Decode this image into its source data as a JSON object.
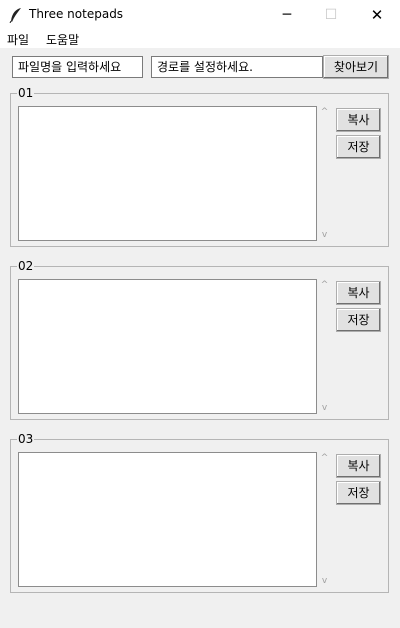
{
  "window": {
    "title": "Three notepads",
    "minimize": "─",
    "maximize": "☐",
    "close": "✕"
  },
  "menu": {
    "items": [
      "파일",
      "도움말"
    ]
  },
  "filename_input": {
    "placeholder": "파일명을 입력하세요"
  },
  "path_input": {
    "placeholder": "경로를 설정하세요."
  },
  "browse_button": "찾아보기",
  "pads": [
    {
      "label": "01",
      "copy": "복사",
      "save": "저장"
    },
    {
      "label": "02",
      "copy": "복사",
      "save": "저장"
    },
    {
      "label": "03",
      "copy": "복사",
      "save": "저장"
    }
  ],
  "scroll": {
    "up": "^",
    "down": "v"
  }
}
